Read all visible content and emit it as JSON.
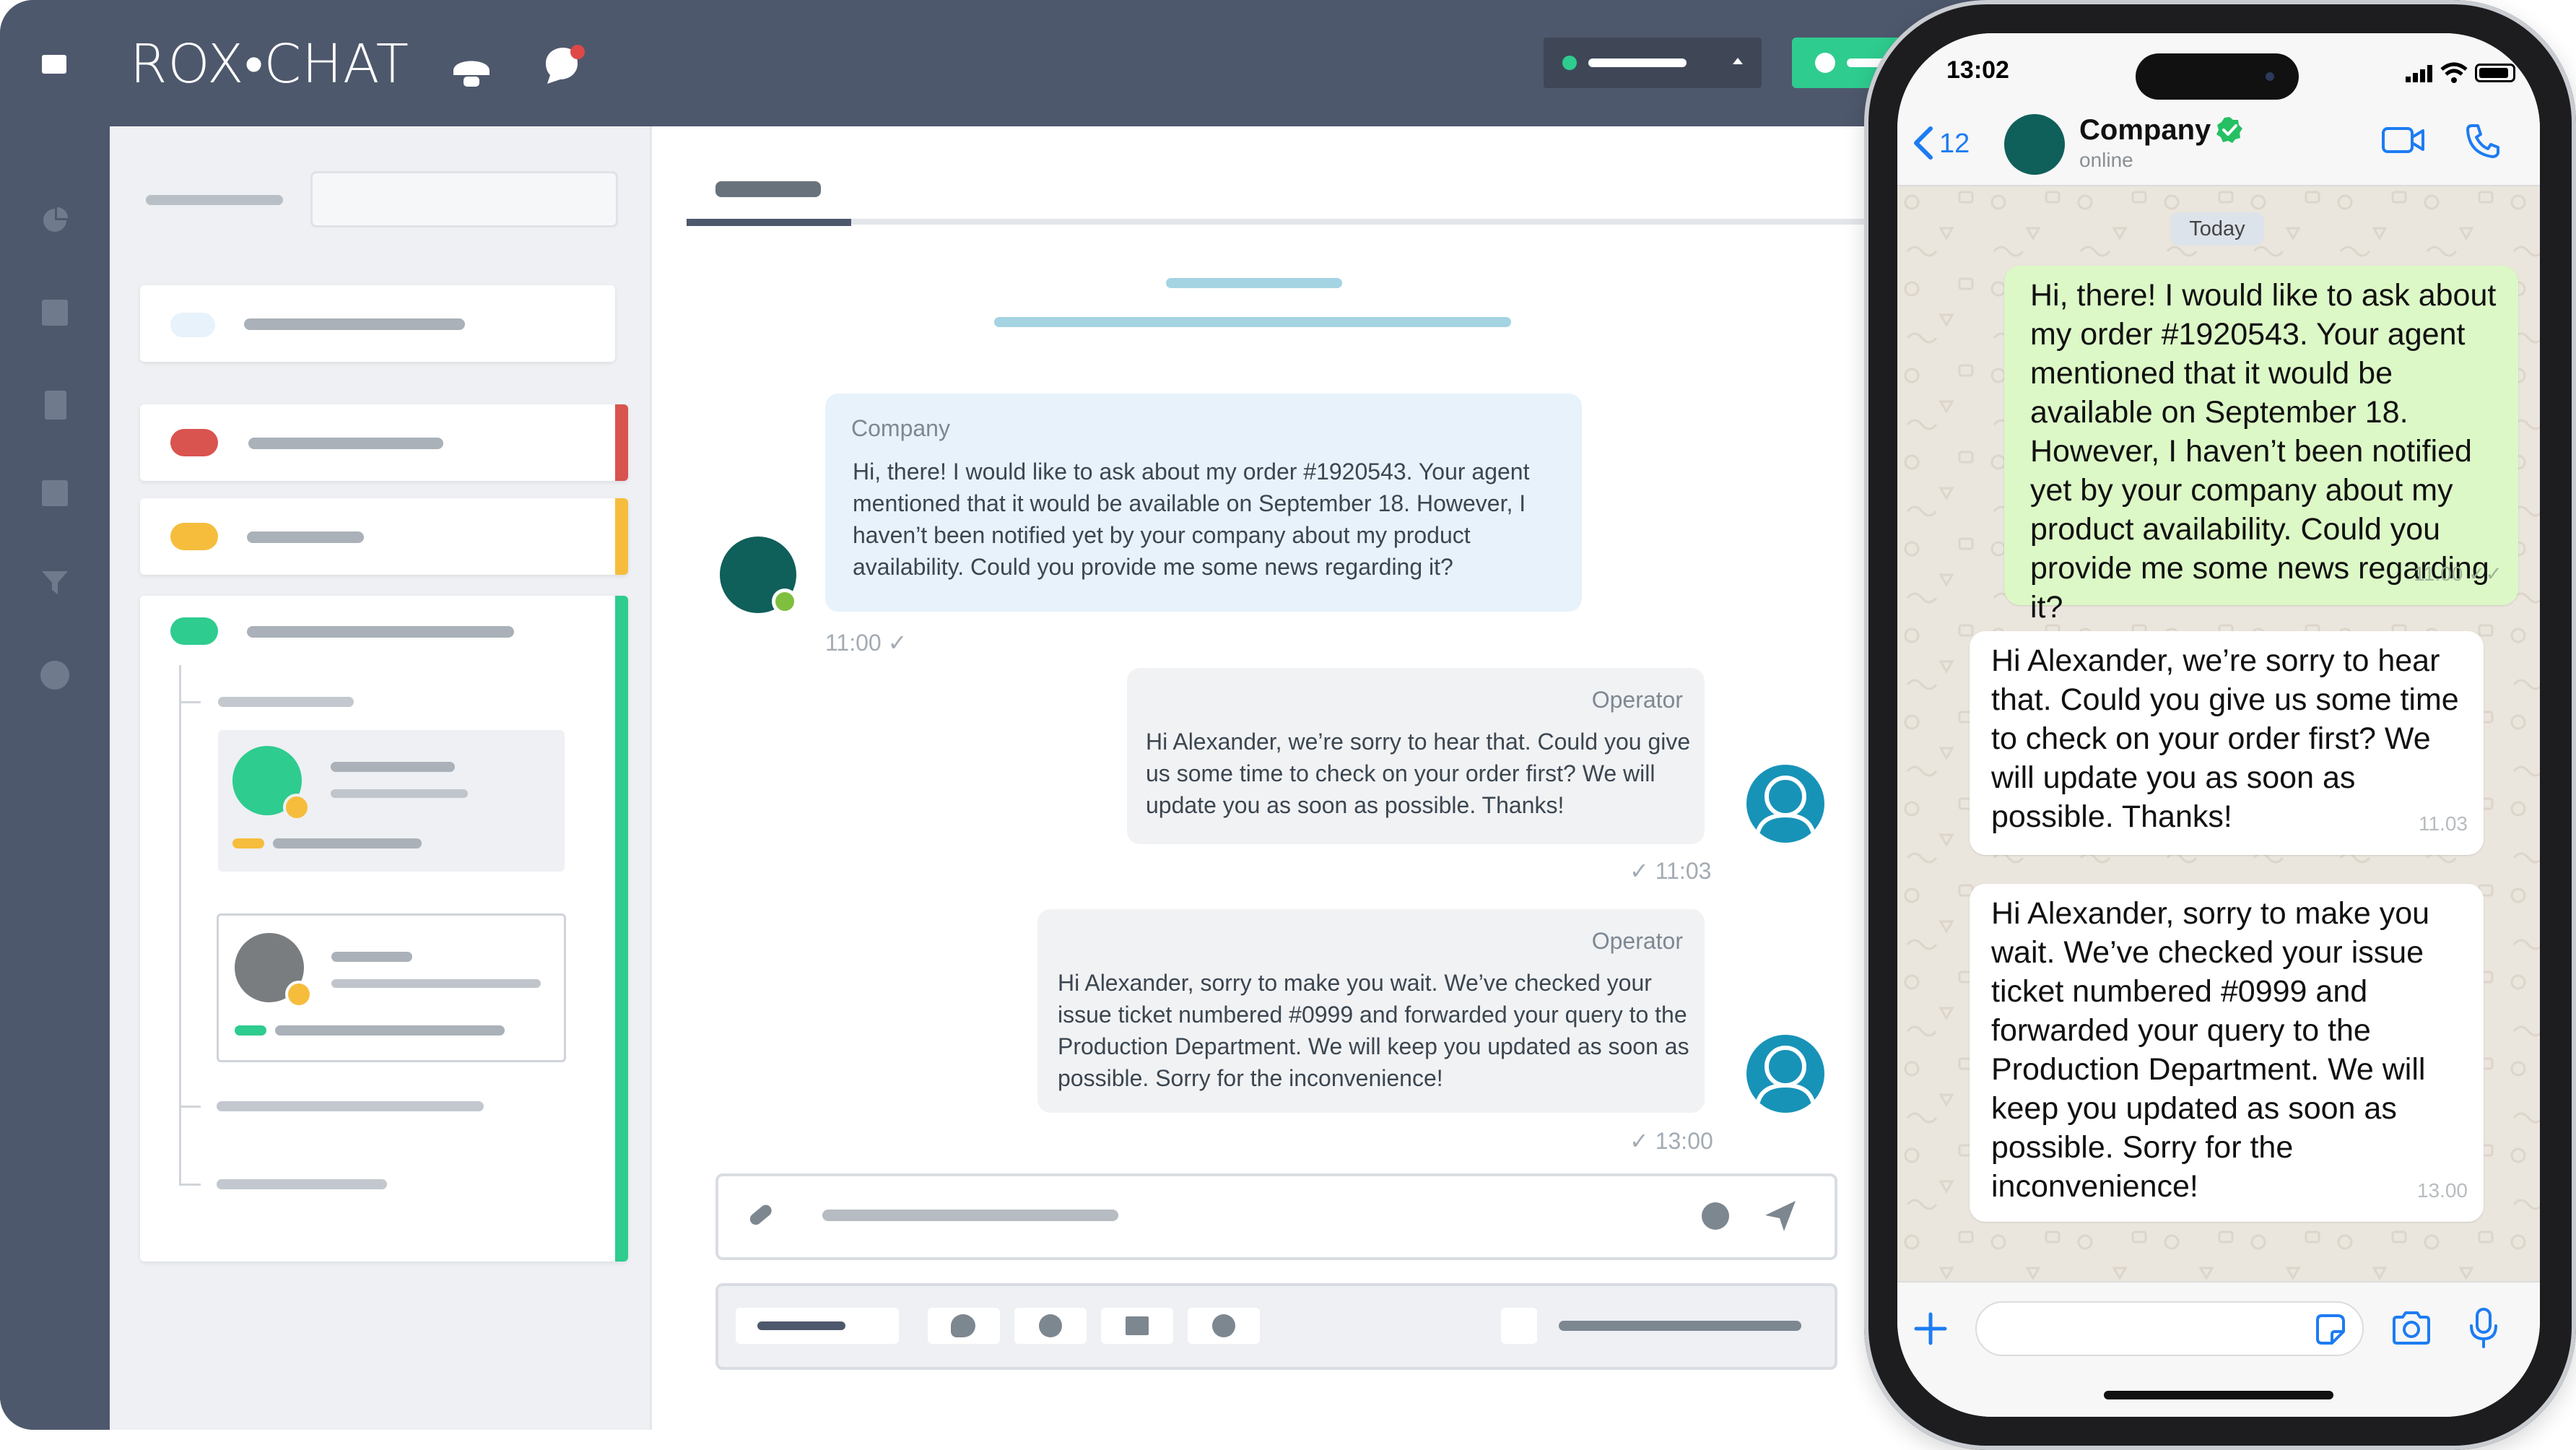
{
  "brand": {
    "logo_text": "ROX•CHAT",
    "accent_green": "#2ecc8f",
    "accent_red": "#d9534f",
    "accent_yellow": "#f6bd3d",
    "accent_blue": "#a4d4e2"
  },
  "chat": {
    "messages": [
      {
        "sender": "Company",
        "text": "Hi, there! I would like to ask about my order #1920543. Your agent mentioned that it would be available on September 18. However, I haven’t been notified yet by your company about my product availability. Could you provide me some news regarding it?",
        "time": "11:00 ✓"
      },
      {
        "sender": "Operator",
        "text": "Hi Alexander, we’re sorry to hear that. Could you give us some time to check on your order first? We will update you as soon as possible. Thanks!",
        "time": "✓ 11:03"
      },
      {
        "sender": "Operator",
        "text": "Hi Alexander, sorry to make you wait. We’ve checked your issue ticket numbered #0999 and forwarded your query to the Production Department. We will keep you updated as soon as possible. Sorry for the inconvenience!",
        "time": "✓ 13:00"
      }
    ]
  },
  "phone": {
    "status_time": "13:02",
    "back_count": "12",
    "contact_name": "Company",
    "contact_status": "online",
    "date_chip": "Today",
    "messages": [
      {
        "text": "Hi, there! I would like to ask about my order #1920543. Your agent mentioned that it would be available on September 18. However, I haven’t been notified yet by your company about my product availability. Could you provide me some news regarding it?",
        "time": "11.00 ✓✓"
      },
      {
        "text": "Hi Alexander, we’re sorry to hear that. Could you give us some time to check on your order first? We will update you as soon as possible. Thanks!",
        "time": "11.03"
      },
      {
        "text": "Hi Alexander, sorry to make you wait. We’ve checked your issue ticket numbered #0999 and forwarded your query to the Production Department. We will keep you updated as soon as possible. Sorry for the inconvenience!",
        "time": "13.00"
      }
    ],
    "icons": {
      "back": "chevron-left-icon",
      "video": "video-camera-icon",
      "call": "phone-icon",
      "add": "plus-icon",
      "sticker": "sticker-icon",
      "camera": "camera-icon",
      "mic": "microphone-icon"
    }
  }
}
